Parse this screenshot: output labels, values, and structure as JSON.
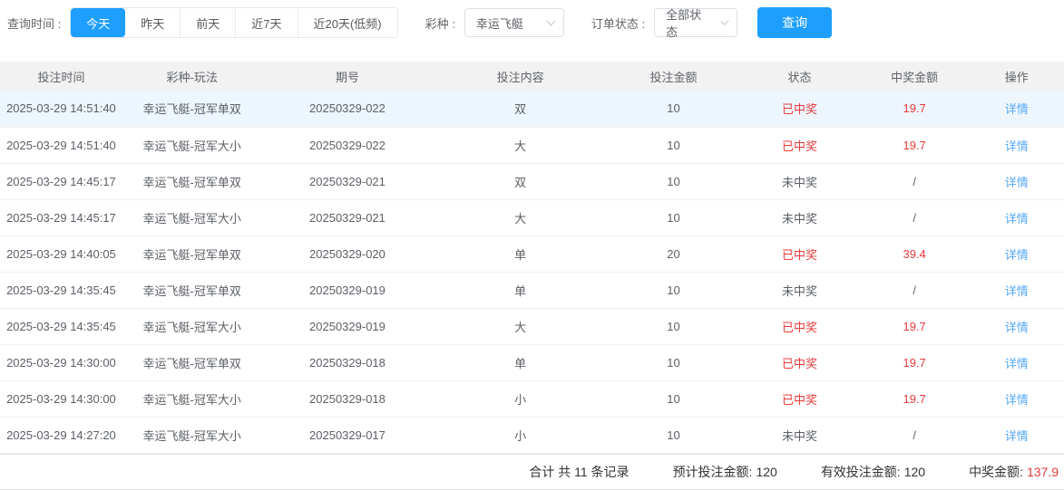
{
  "filters": {
    "time_label": "查询时间 :",
    "time_options": [
      {
        "label": "今天",
        "active": true
      },
      {
        "label": "昨天",
        "active": false
      },
      {
        "label": "前天",
        "active": false
      },
      {
        "label": "近7天",
        "active": false
      },
      {
        "label": "近20天(低频)",
        "active": false
      }
    ],
    "lottery_label": "彩种 :",
    "lottery_value": "幸运飞艇",
    "status_label": "订单状态 :",
    "status_value": "全部状态",
    "search_label": "查询"
  },
  "table": {
    "columns": [
      "投注时间",
      "彩种-玩法",
      "期号",
      "投注内容",
      "投注金额",
      "状态",
      "中奖金额",
      "操作"
    ],
    "rows": [
      {
        "time": "2025-03-29 14:51:40",
        "play": "幸运飞艇-冠军单双",
        "issue": "20250329-022",
        "content": "双",
        "amount": "10",
        "status": "已中奖",
        "won": true,
        "prize": "19.7",
        "action": "详情",
        "highlight": true
      },
      {
        "time": "2025-03-29 14:51:40",
        "play": "幸运飞艇-冠军大小",
        "issue": "20250329-022",
        "content": "大",
        "amount": "10",
        "status": "已中奖",
        "won": true,
        "prize": "19.7",
        "action": "详情",
        "highlight": false
      },
      {
        "time": "2025-03-29 14:45:17",
        "play": "幸运飞艇-冠军单双",
        "issue": "20250329-021",
        "content": "双",
        "amount": "10",
        "status": "未中奖",
        "won": false,
        "prize": "/",
        "action": "详情",
        "highlight": false
      },
      {
        "time": "2025-03-29 14:45:17",
        "play": "幸运飞艇-冠军大小",
        "issue": "20250329-021",
        "content": "大",
        "amount": "10",
        "status": "未中奖",
        "won": false,
        "prize": "/",
        "action": "详情",
        "highlight": false
      },
      {
        "time": "2025-03-29 14:40:05",
        "play": "幸运飞艇-冠军单双",
        "issue": "20250329-020",
        "content": "单",
        "amount": "20",
        "status": "已中奖",
        "won": true,
        "prize": "39.4",
        "action": "详情",
        "highlight": false
      },
      {
        "time": "2025-03-29 14:35:45",
        "play": "幸运飞艇-冠军单双",
        "issue": "20250329-019",
        "content": "单",
        "amount": "10",
        "status": "未中奖",
        "won": false,
        "prize": "/",
        "action": "详情",
        "highlight": false
      },
      {
        "time": "2025-03-29 14:35:45",
        "play": "幸运飞艇-冠军大小",
        "issue": "20250329-019",
        "content": "大",
        "amount": "10",
        "status": "已中奖",
        "won": true,
        "prize": "19.7",
        "action": "详情",
        "highlight": false
      },
      {
        "time": "2025-03-29 14:30:00",
        "play": "幸运飞艇-冠军单双",
        "issue": "20250329-018",
        "content": "单",
        "amount": "10",
        "status": "已中奖",
        "won": true,
        "prize": "19.7",
        "action": "详情",
        "highlight": false
      },
      {
        "time": "2025-03-29 14:30:00",
        "play": "幸运飞艇-冠军大小",
        "issue": "20250329-018",
        "content": "小",
        "amount": "10",
        "status": "已中奖",
        "won": true,
        "prize": "19.7",
        "action": "详情",
        "highlight": false
      },
      {
        "time": "2025-03-29 14:27:20",
        "play": "幸运飞艇-冠军大小",
        "issue": "20250329-017",
        "content": "小",
        "amount": "10",
        "status": "未中奖",
        "won": false,
        "prize": "/",
        "action": "详情",
        "highlight": false
      }
    ]
  },
  "summary": {
    "total_text": "合计 共 11 条记录",
    "expected_label": "预计投注金额:",
    "expected_value": "120",
    "valid_label": "有效投注金额:",
    "valid_value": "120",
    "prize_label": "中奖金额:",
    "prize_value": "137.9"
  },
  "colors": {
    "accent_blue": "#1e9fff",
    "link_blue": "#54a7f7",
    "status_red": "#e83b3b",
    "row_highlight": "#eef6fd",
    "header_bg": "#f2f2f2"
  }
}
